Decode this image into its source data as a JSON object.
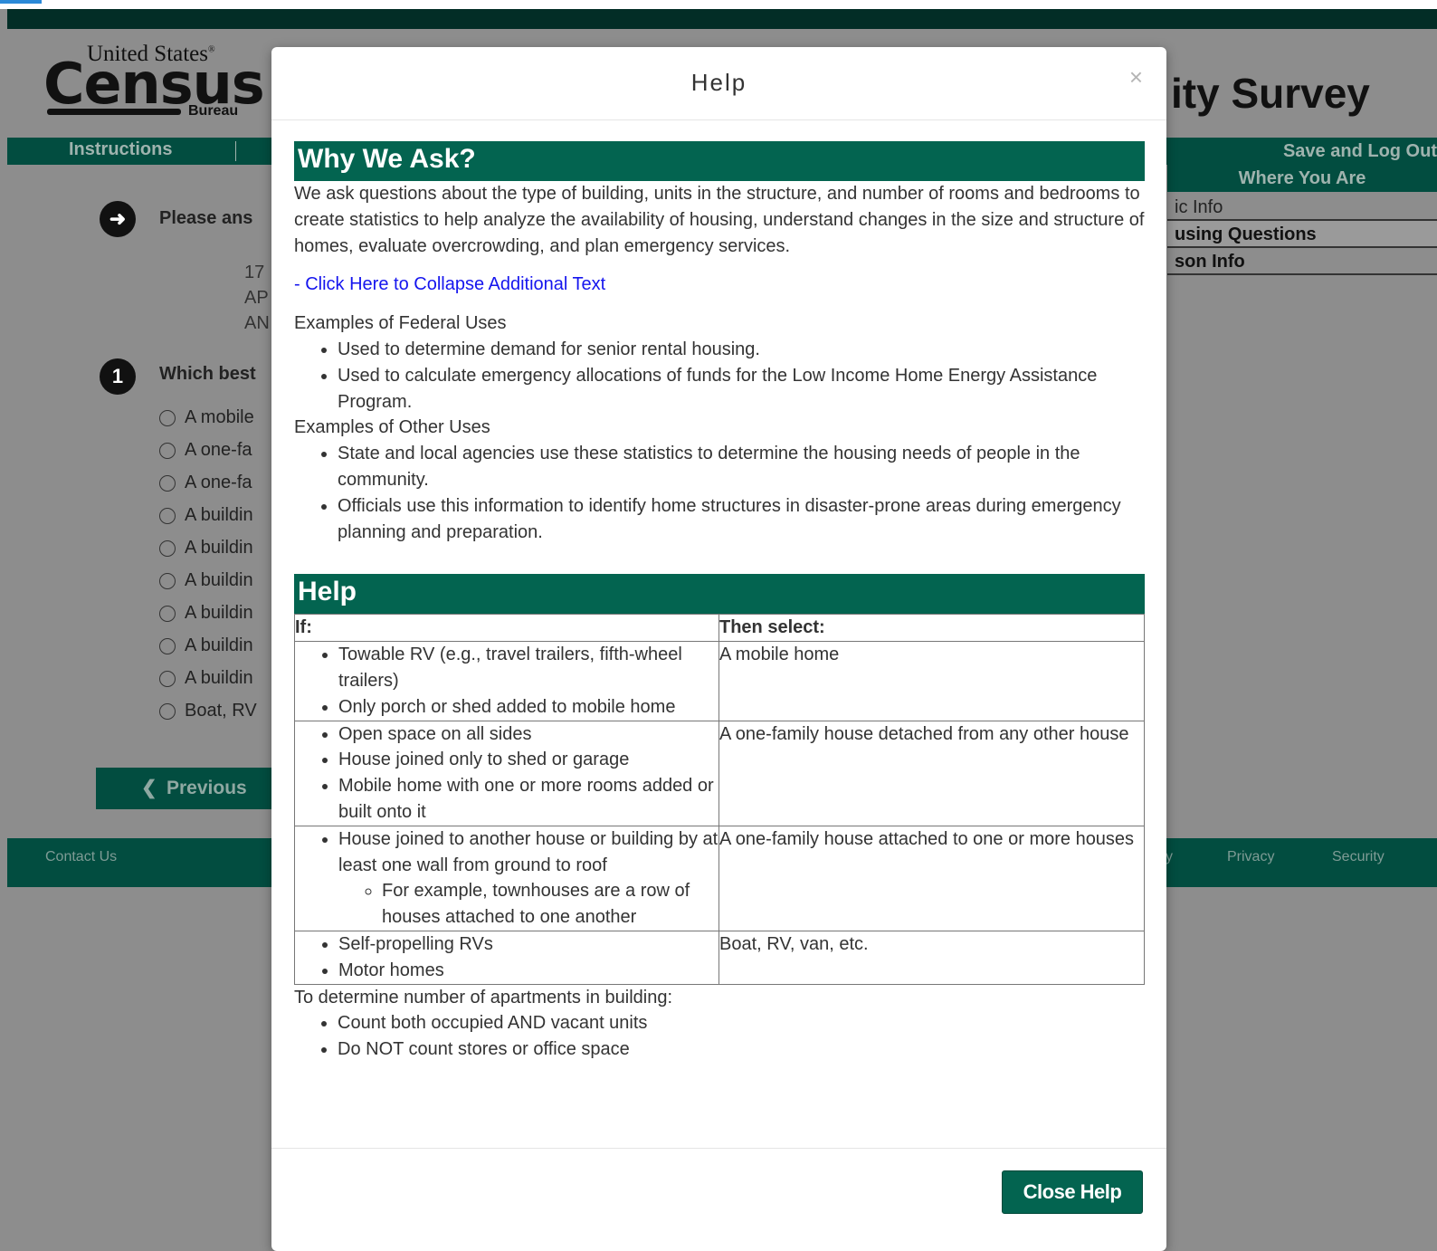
{
  "background": {
    "logo": {
      "line1": "United States",
      "reg": "®",
      "wordmark": "Census",
      "bureau": "Bureau"
    },
    "title_fragment": "ity Survey",
    "nav": {
      "instructions": "Instructions",
      "save_logout": "Save and Log Out"
    },
    "sidebar": {
      "heading": "Where You Are",
      "items": [
        "ic Info",
        "using Questions",
        "son Info"
      ]
    },
    "arrow_icon": "arrow-right-circle-icon",
    "question_intro": "Please ans",
    "address_lines": [
      "17",
      "AP",
      "AN"
    ],
    "question_number": "1",
    "question_text": "Which best",
    "options": [
      "A mobile",
      "A one-fa",
      "A one-fa",
      "A buildin",
      "A buildin",
      "A buildin",
      "A buildin",
      "A buildin",
      "A buildin",
      "Boat, RV"
    ],
    "previous_button": "Previous",
    "footer": {
      "contact": "Contact Us",
      "y_fragment": "y",
      "privacy": "Privacy",
      "security": "Security"
    }
  },
  "modal": {
    "title": "Help",
    "close_glyph": "×",
    "why_heading": "Why We Ask?",
    "why_text": "We ask questions about the type of building, units in the structure, and number of rooms and bedrooms to create statistics to help analyze the availability of housing, understand changes in the size and structure of homes, evaluate overcrowding, and plan emergency services.",
    "collapse_link": "- Click Here to Collapse Additional Text",
    "federal_label": "Examples of Federal Uses",
    "federal_uses": [
      "Used to determine demand for senior rental housing.",
      "Used to calculate emergency allocations of funds for the Low Income Home Energy Assistance Program."
    ],
    "other_label": "Examples of Other Uses",
    "other_uses": [
      "State and local agencies use these statistics to determine the housing needs of people in the community.",
      "Officials use this information to identify home structures in disaster-prone areas during emergency planning and preparation."
    ],
    "help_heading": "Help",
    "table": {
      "col_if": "If:",
      "col_then": "Then select:",
      "rows": [
        {
          "conditions": [
            "Towable RV (e.g., travel trailers, fifth-wheel trailers)",
            "Only porch or shed added to mobile home"
          ],
          "select": "A mobile home"
        },
        {
          "conditions": [
            "Open space on all sides",
            "House joined only to shed or garage",
            "Mobile home with one or more rooms added or built onto it"
          ],
          "select": "A one-family house detached from any other house"
        },
        {
          "conditions": [
            "House joined to another house or building by at least one wall from ground to roof"
          ],
          "sub": "For example, townhouses are a row of houses attached to one another",
          "select": "A one-family house attached to one or more houses"
        },
        {
          "conditions": [
            "Self-propelling RVs",
            "Motor homes"
          ],
          "select": "Boat, RV, van, etc."
        }
      ]
    },
    "apartments_label": "To determine number of apartments in building:",
    "apartments_rules": [
      "Count both occupied AND vacant units",
      "Do NOT count stores or office space"
    ],
    "close_button": "Close Help"
  }
}
